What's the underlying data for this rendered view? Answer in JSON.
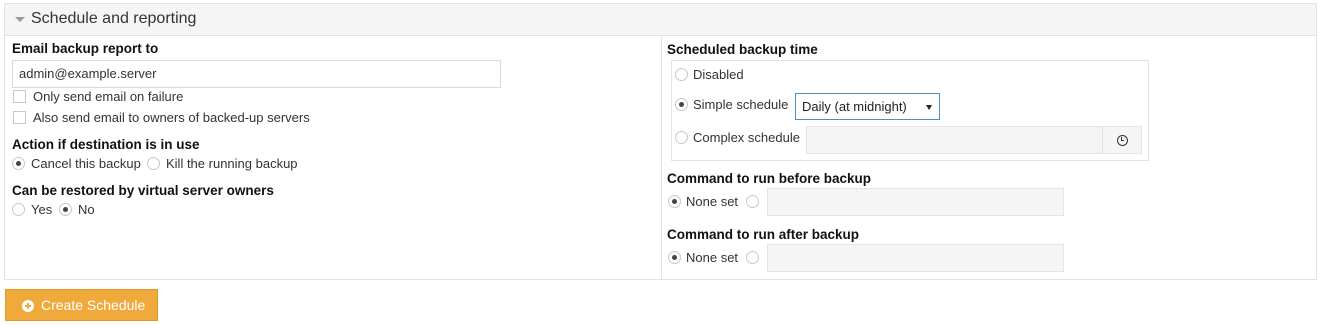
{
  "section": {
    "title": "Schedule and reporting",
    "collapse_icon": "caret-down-icon"
  },
  "email": {
    "label": "Email backup report to",
    "value": "admin@example.server",
    "only_failure_label": "Only send email on failure",
    "only_failure_checked": false,
    "owners_label": "Also send email to owners of backed-up servers",
    "owners_checked": false
  },
  "destination": {
    "label": "Action if destination is in use",
    "options": [
      "Cancel this backup",
      "Kill the running backup"
    ],
    "selected": "Cancel this backup"
  },
  "restore": {
    "label": "Can be restored by virtual server owners",
    "options": [
      "Yes",
      "No"
    ],
    "selected": "No"
  },
  "schedule": {
    "label": "Scheduled backup time",
    "options": [
      "Disabled",
      "Simple schedule",
      "Complex schedule"
    ],
    "selected": "Simple schedule",
    "simple_value": "Daily (at midnight)",
    "complex_value": "",
    "cron_icon": "clock-icon"
  },
  "before_cmd": {
    "label": "Command to run before backup",
    "none_label": "None set",
    "selected": "None set",
    "value": ""
  },
  "after_cmd": {
    "label": "Command to run after backup",
    "none_label": "None set",
    "selected": "None set",
    "value": ""
  },
  "actions": {
    "create_label": "Create Schedule",
    "create_icon": "plus-circle-icon",
    "accent": "#f0a93b"
  }
}
